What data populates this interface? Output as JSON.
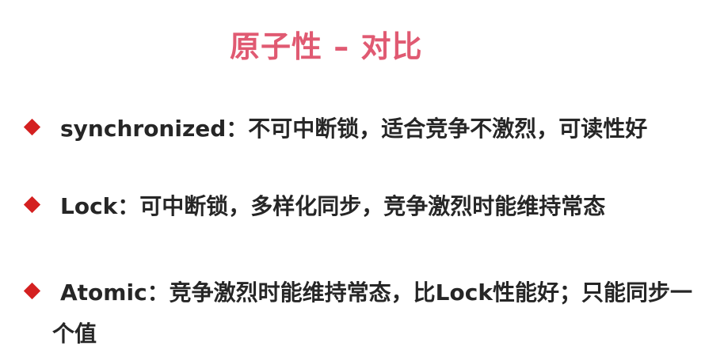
{
  "slide": {
    "title": "原子性 – 对比",
    "bullets": [
      {
        "text": "synchronized：不可中断锁，适合竞争不激烈，可读性好"
      },
      {
        "text": "Lock：可中断锁，多样化同步，竞争激烈时能维持常态"
      },
      {
        "text": "Atomic：竞争激烈时能维持常态，比Lock性能好；只能同步一",
        "continuation": "个值"
      }
    ],
    "colors": {
      "title": "#e05a72",
      "bullet_marker": "#d42020",
      "body_text": "#262626"
    }
  }
}
